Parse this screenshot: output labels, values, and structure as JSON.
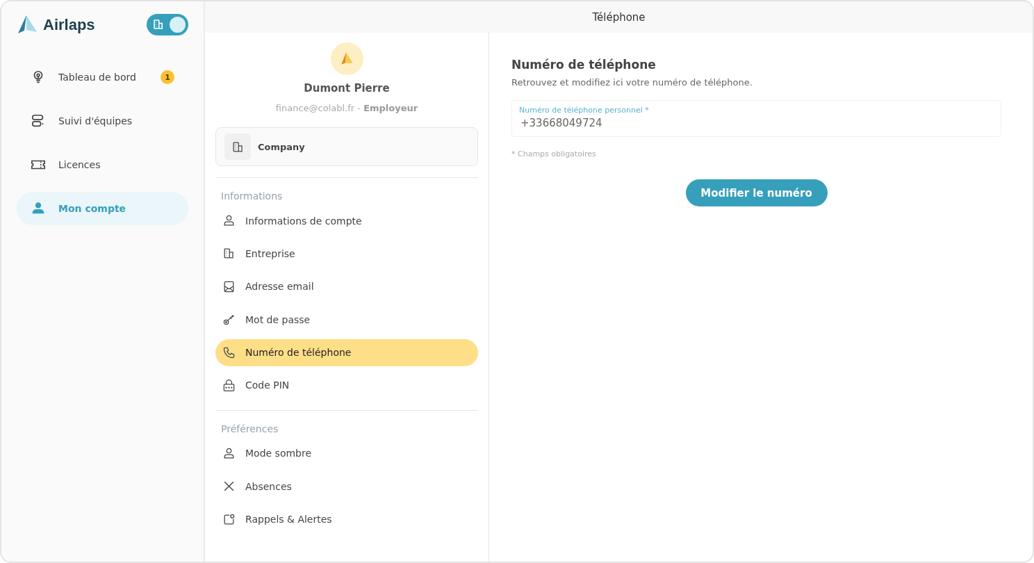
{
  "sidebar": {
    "logo": "Airlaps",
    "mode_switch": {
      "on": true
    },
    "items": [
      {
        "label": "Tableau de bord",
        "badge": "1",
        "selected": false
      },
      {
        "label": "Suivi d'équipes",
        "selected": false
      },
      {
        "label": "Licences",
        "selected": false
      },
      {
        "label": "Mon compte",
        "selected": true
      }
    ]
  },
  "header": {
    "title": "Téléphone"
  },
  "profile": {
    "name": "Dumont Pierre",
    "email": "finance@colabl.fr",
    "separator": "-",
    "role": "Employeur",
    "company": "Company"
  },
  "sections": [
    {
      "title": "Informations",
      "items": [
        {
          "label": "Informations de compte",
          "selected": false
        },
        {
          "label": "Entreprise",
          "selected": false
        },
        {
          "label": "Adresse email",
          "selected": false
        },
        {
          "label": "Mot de passe",
          "selected": false
        },
        {
          "label": "Numéro de téléphone",
          "selected": true
        },
        {
          "label": "Code PIN",
          "selected": false
        }
      ]
    },
    {
      "title": "Préférences",
      "items": [
        {
          "label": "Mode sombre",
          "selected": false
        },
        {
          "label": "Absences",
          "selected": false
        },
        {
          "label": "Rappels & Alertes",
          "selected": false
        }
      ]
    }
  ],
  "form": {
    "title": "Numéro de téléphone",
    "description": "Retrouvez et modifiez ici votre numéro de téléphone.",
    "field_label": "Numéro de téléphone personnel *",
    "field_value": "+33668049724",
    "note": "* Champs obligatoires",
    "button": "Modifier le numéro"
  }
}
